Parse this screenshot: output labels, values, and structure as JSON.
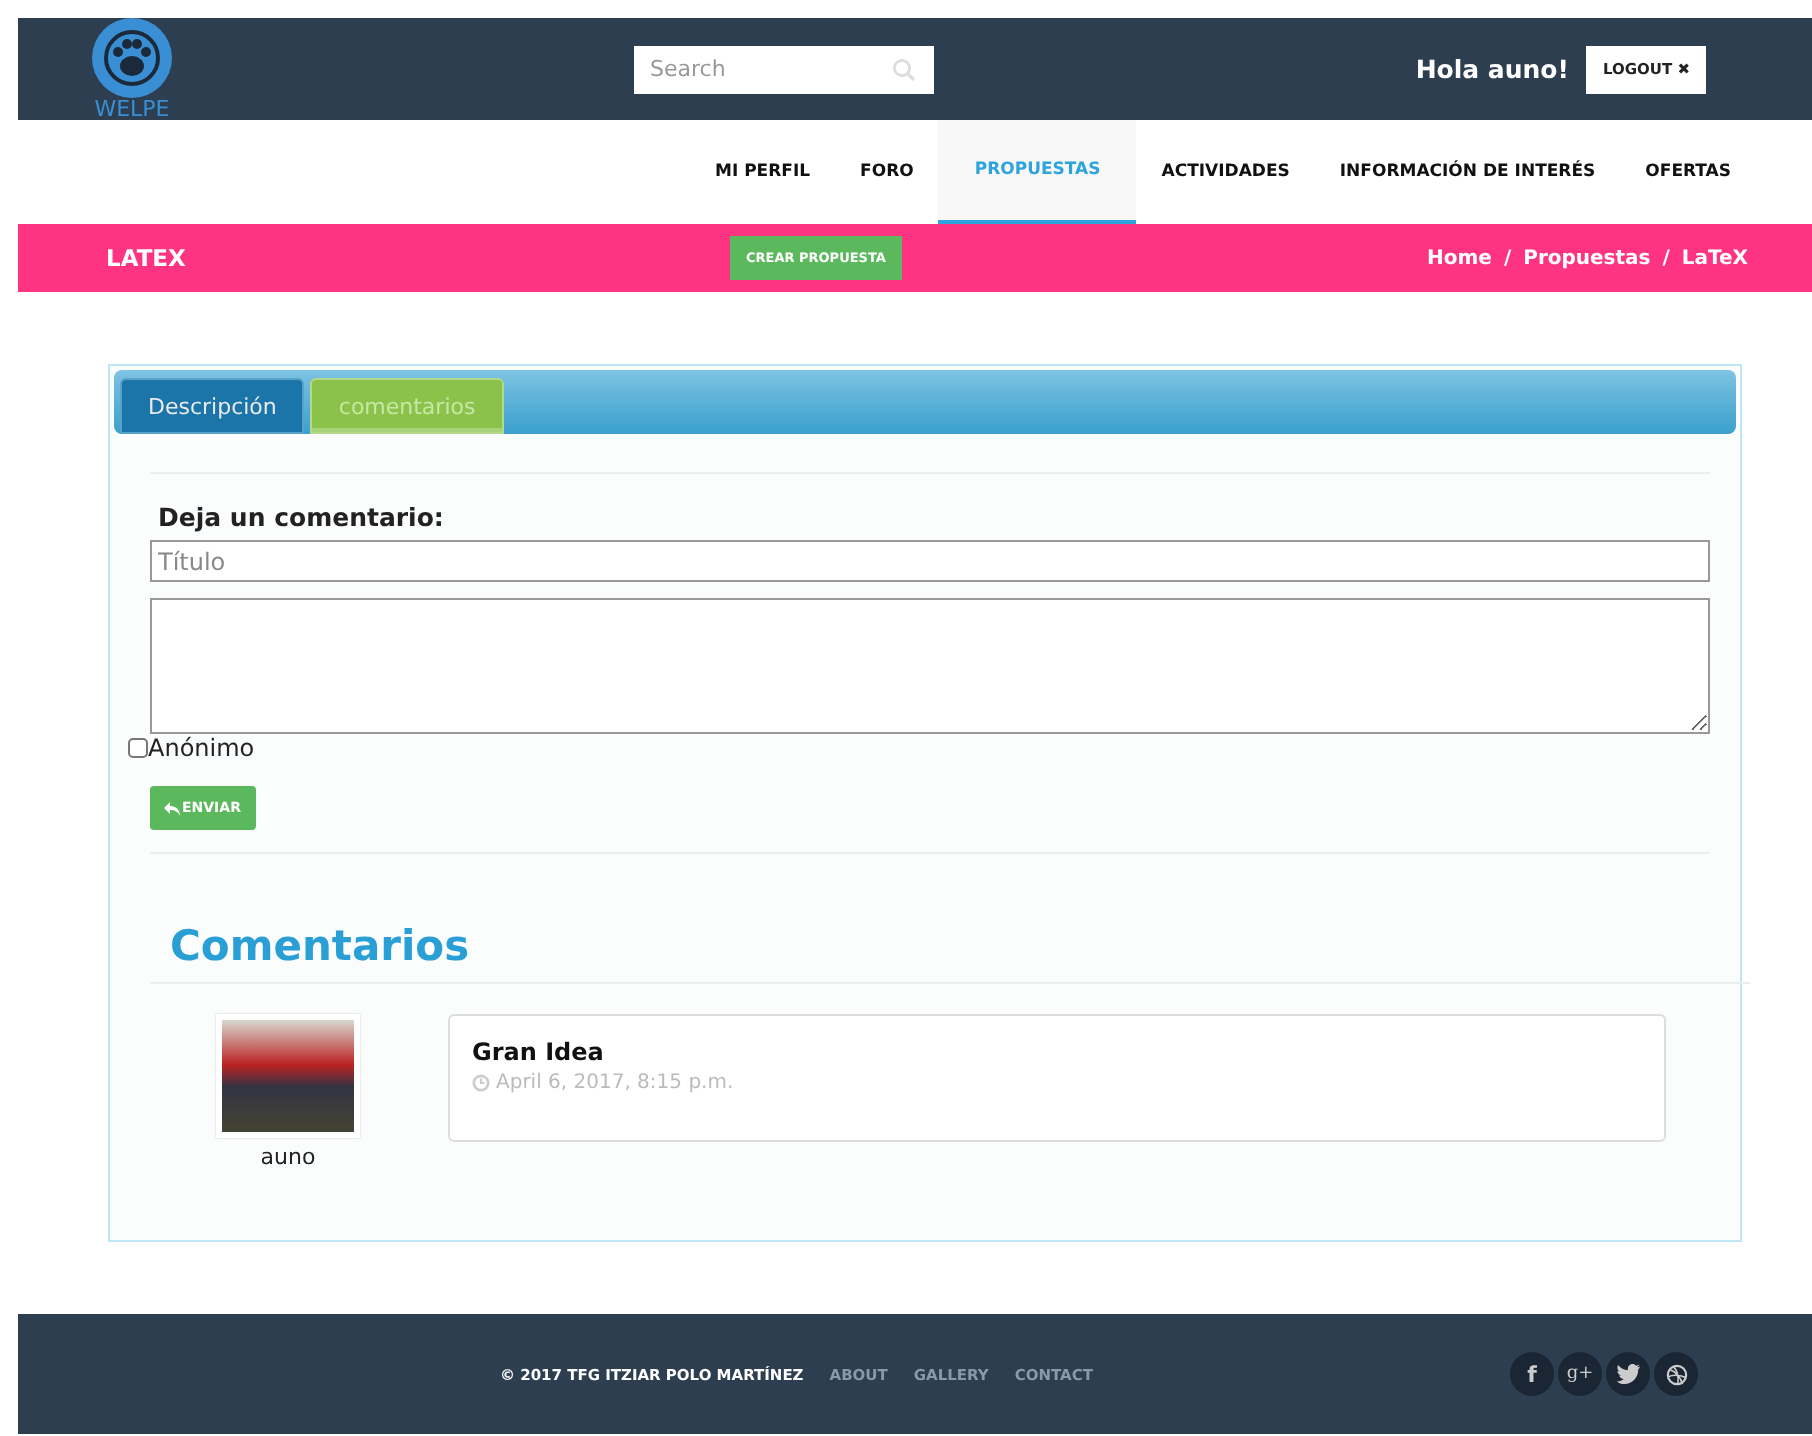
{
  "header": {
    "logo": "WELPE",
    "search": {
      "placeholder": "Search"
    },
    "greeting": "Hola auno!",
    "logout": "LOGOUT ✖"
  },
  "nav": [
    {
      "label": "MI PERFIL",
      "selected": false
    },
    {
      "label": "FORO",
      "selected": false
    },
    {
      "label": "PROPUESTAS",
      "selected": true
    },
    {
      "label": "ACTIVIDADES",
      "selected": false
    },
    {
      "label": "INFORMACIÓN DE INTERÉS",
      "selected": false
    },
    {
      "label": "OFERTAS",
      "selected": false
    }
  ],
  "page_bar": {
    "title": "LATEX",
    "action": "CREAR PROPUESTA",
    "breadcrumb": [
      "Home",
      "Propuestas",
      "LaTeX"
    ],
    "separator": "/"
  },
  "tabs": [
    {
      "label": "Descripción",
      "selected": false
    },
    {
      "label": "comentarios",
      "selected": true
    }
  ],
  "form": {
    "heading": "Deja un comentario:",
    "title_field": {
      "placeholder": "Título"
    },
    "anonymous": {
      "label": "Anónimo",
      "checked": false
    },
    "submit": "ENVIAR"
  },
  "comments_heading": "Comentarios",
  "comments": [
    {
      "author": "auno",
      "title": "Gran Idea",
      "date": "April 6, 2017, 8:15 p.m."
    }
  ],
  "footer": {
    "copyright": "© 2017 TFG ITZIAR POLO MARTÍNEZ",
    "links": [
      "ABOUT",
      "GALLERY",
      "CONTACT"
    ],
    "social": [
      {
        "kind": "facebook",
        "glyph": "f"
      },
      {
        "kind": "googleplus",
        "glyph": "g+"
      },
      {
        "kind": "twitter"
      },
      {
        "kind": "dribbble"
      }
    ]
  }
}
